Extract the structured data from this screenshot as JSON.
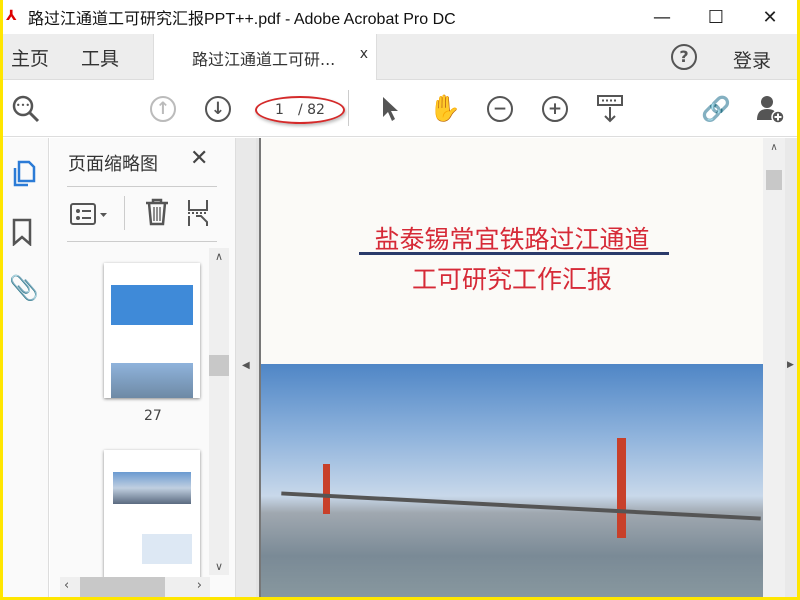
{
  "window": {
    "title": "路过江通道工可研究汇报PPT++.pdf - Adobe Acrobat Pro DC",
    "minimize": "—",
    "maximize": "☐",
    "close": "✕"
  },
  "tabs": {
    "home": "主页",
    "tools": "工具",
    "document": "路过江通道工可研...",
    "document_close": "x",
    "help": "?",
    "login": "登录"
  },
  "toolbar": {
    "current_page": "1",
    "total_pages": "/ 82"
  },
  "panel": {
    "title": "页面缩略图",
    "close": "✕",
    "thumbnails": [
      {
        "label": "27"
      },
      {
        "label": ""
      }
    ]
  },
  "document": {
    "title_line1": "盐泰锡常宜铁路过江通道",
    "title_line2": "工可研究工作汇报"
  },
  "colors": {
    "accent": "#2b7bd6",
    "title_red": "#d62a37",
    "highlight_ring": "#d42a2a",
    "border": "#ffe600"
  }
}
